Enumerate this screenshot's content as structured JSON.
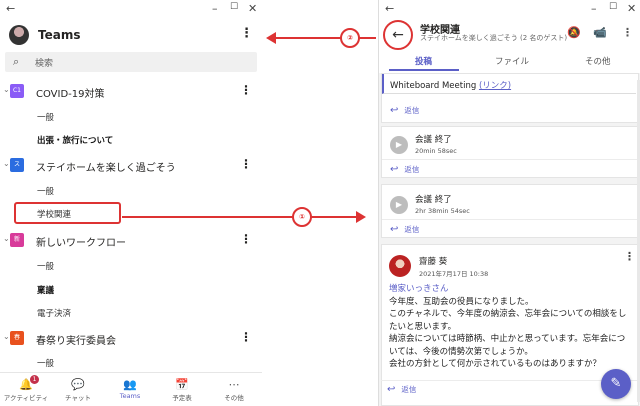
{
  "left": {
    "window_controls": {
      "back": "←",
      "min": "–",
      "max": "☐",
      "close": "✕"
    },
    "header_title": "Teams",
    "search_placeholder": "検索",
    "teams": [
      {
        "name": "COVID-19対策",
        "tile": "C1",
        "color": "#8a5cf6",
        "channels": [
          {
            "label": "一般"
          },
          {
            "label": "出張・旅行について",
            "bold": true
          }
        ]
      },
      {
        "name": "ステイホームを楽しく過ごそう",
        "tile": "ス",
        "color": "#2b6ce0",
        "channels": [
          {
            "label": "一般"
          },
          {
            "label": "学校関連"
          }
        ]
      },
      {
        "name": "新しいワークフロー",
        "tile": "新",
        "color": "#d83b9a",
        "channels": [
          {
            "label": "一般"
          },
          {
            "label": "稟議",
            "bold": true
          },
          {
            "label": "電子決済"
          }
        ]
      },
      {
        "name": "春祭り実行委員会",
        "tile": "春",
        "color": "#e8511e",
        "channels": [
          {
            "label": "一般"
          }
        ]
      }
    ],
    "nav": [
      {
        "label": "アクティビティ",
        "icon": "bell-icon",
        "glyph": "🔔",
        "badge": "1"
      },
      {
        "label": "チャット",
        "icon": "chat-icon",
        "glyph": "💬"
      },
      {
        "label": "Teams",
        "icon": "teams-icon",
        "glyph": "👥",
        "active": true
      },
      {
        "label": "予定表",
        "icon": "calendar-icon",
        "glyph": "📅"
      },
      {
        "label": "その他",
        "icon": "more-icon",
        "glyph": "⋯"
      }
    ]
  },
  "right": {
    "channel_title": "学校関連",
    "channel_subtitle": "ステイホームを楽しく過ごそう (2 名のゲスト)",
    "tabs": [
      "投稿",
      "ファイル",
      "その他"
    ],
    "whiteboard": {
      "text": "Whiteboard Meeting ",
      "link": "(リンク)"
    },
    "reply_label": "返信",
    "meetings": [
      {
        "title": "会議 終了",
        "duration": "20min 58sec"
      },
      {
        "title": "会議 終了",
        "duration": "2hr 38min 54sec"
      }
    ],
    "post": {
      "author": "齋藤 葵",
      "date": "2021年7月17日 10:38",
      "mention": "増家いっきさん",
      "lines": [
        "今年度、互助会の役員になりました。",
        "このチャネルで、今年度の納涼会、忘年会についての相談をし",
        "たいと思います。",
        "納涼会については時節柄、中止かと思っています。忘年会につ",
        "いては、今後の情勢次第でしょうか。",
        "会社の方針として何か示されているものはありますか？"
      ]
    }
  },
  "annotations": {
    "step1": "①",
    "step2": "②",
    "accent": "#d33333"
  }
}
